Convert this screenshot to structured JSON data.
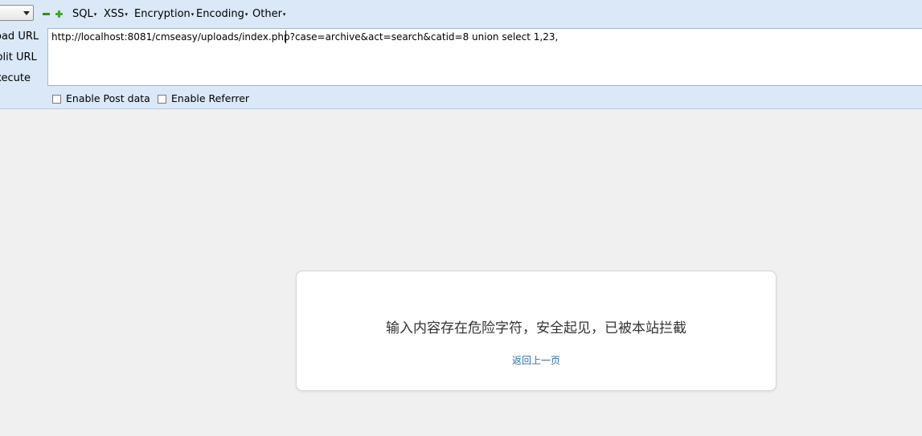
{
  "hackbar": {
    "menus": {
      "sql": "SQL",
      "xss": "XSS",
      "encryption": "Encryption",
      "encoding": "Encoding",
      "other": "Other"
    },
    "dropdown_glyph": "▾",
    "side_actions": {
      "load_url": "Load URL",
      "split_url": "Split URL",
      "execute": "Execute"
    },
    "url_value": "http://localhost:8081/cmseasy/uploads/index.php?case=archive&act=search&catid=8 union select 1,23,",
    "options": {
      "enable_post": "Enable Post data",
      "enable_referrer": "Enable Referrer"
    }
  },
  "page": {
    "message": "输入内容存在危险字符，安全起见，已被本站拦截",
    "back_link": "返回上一页"
  }
}
